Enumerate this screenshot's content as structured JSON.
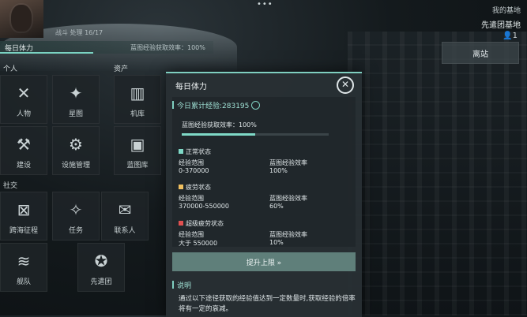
{
  "top": {
    "dots": "•••",
    "rank_text": "…",
    "rank_status": "战斗  处理 16/17",
    "exp_label": "每日体力",
    "exp_rate": "蓝图经验获取效率：100%",
    "exp_fill": 0.44,
    "base_line1": "我的基地",
    "base_line2": "先遣团基地",
    "leave_label": "离站"
  },
  "left": {
    "sections": {
      "personal": "个人",
      "assets": "资产",
      "social": "社交"
    },
    "tiles": [
      {
        "label": "人物",
        "icon": "person-icon"
      },
      {
        "label": "星图",
        "icon": "star-map-icon"
      },
      {
        "label": "机库",
        "icon": "hangar-icon"
      },
      {
        "label": "建设",
        "icon": "hammer-icon"
      },
      {
        "label": "设施管理",
        "icon": "facility-icon"
      },
      {
        "label": "蓝图库",
        "icon": "blueprint-icon"
      },
      {
        "label": "跨海征程",
        "icon": "expedition-icon"
      },
      {
        "label": "任务",
        "icon": "task-icon"
      },
      {
        "label": "联系人",
        "icon": "contacts-icon"
      },
      {
        "label": "舰队",
        "icon": "fleet-icon"
      },
      {
        "label": "先遣团",
        "icon": "vanguard-icon"
      }
    ]
  },
  "dialog": {
    "title": "每日体力",
    "close_icon": "close-icon",
    "exp_total_label": "今日累计经验:283195",
    "rate_label": "蓝图经验获取效率：100%",
    "rate_value": 0.5,
    "states": [
      {
        "name": "正常状态",
        "color": "#7fd9c7",
        "range_label": "经验范围",
        "range": "0-370000",
        "eff_label": "蓝图经验效率",
        "eff": "100%"
      },
      {
        "name": "疲劳状态",
        "color": "#f0c060",
        "range_label": "经验范围",
        "range": "370000-550000",
        "eff_label": "蓝图经验效率",
        "eff": "60%"
      },
      {
        "name": "超级疲劳状态",
        "color": "#e05050",
        "range_label": "经验范围",
        "range": "大于 550000",
        "eff_label": "蓝图经验效率",
        "eff": "10%"
      }
    ],
    "raise_label": "提升上限 »",
    "note_title": "说明",
    "note_text": "通过以下途径获取的经验值达到一定数量时,获取经验的倍率将有一定的衰减。"
  }
}
